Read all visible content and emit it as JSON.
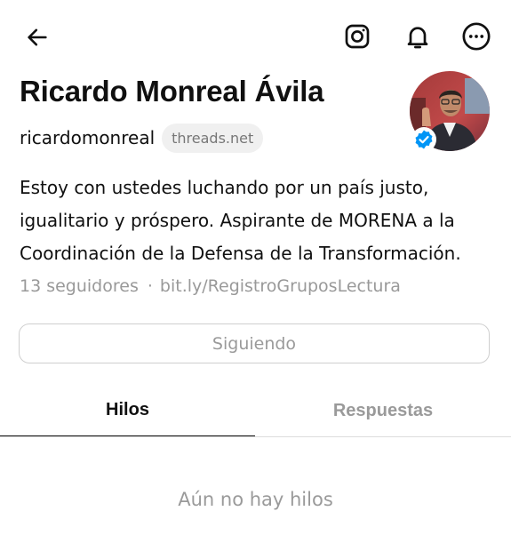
{
  "topbar": {
    "back_icon": "arrow-left-icon",
    "instagram_icon": "instagram-icon",
    "notifications_icon": "bell-icon",
    "more_icon": "more-horizontal-icon"
  },
  "profile": {
    "name": "Ricardo Monreal Ávila",
    "username": "ricardomonreal",
    "domain_chip": "threads.net",
    "verified": true,
    "bio_lines": [
      "Estoy con ustedes luchando por un país justo,",
      "igualitario y próspero. Aspirante de MORENA a la",
      "Coordinación de la Defensa de la Transformación."
    ],
    "followers": "13 seguidores",
    "separator": "·",
    "link": "bit.ly/RegistroGruposLectura"
  },
  "actions": {
    "follow_label": "Siguiendo"
  },
  "tabs": [
    {
      "label": "Hilos",
      "active": true
    },
    {
      "label": "Respuestas",
      "active": false
    }
  ],
  "empty_state": "Aún no hay hilos",
  "colors": {
    "text": "#101010",
    "muted": "#999999",
    "verified": "#0095f6",
    "chip_bg": "#f0f0f0",
    "border": "#cfcfcf"
  }
}
